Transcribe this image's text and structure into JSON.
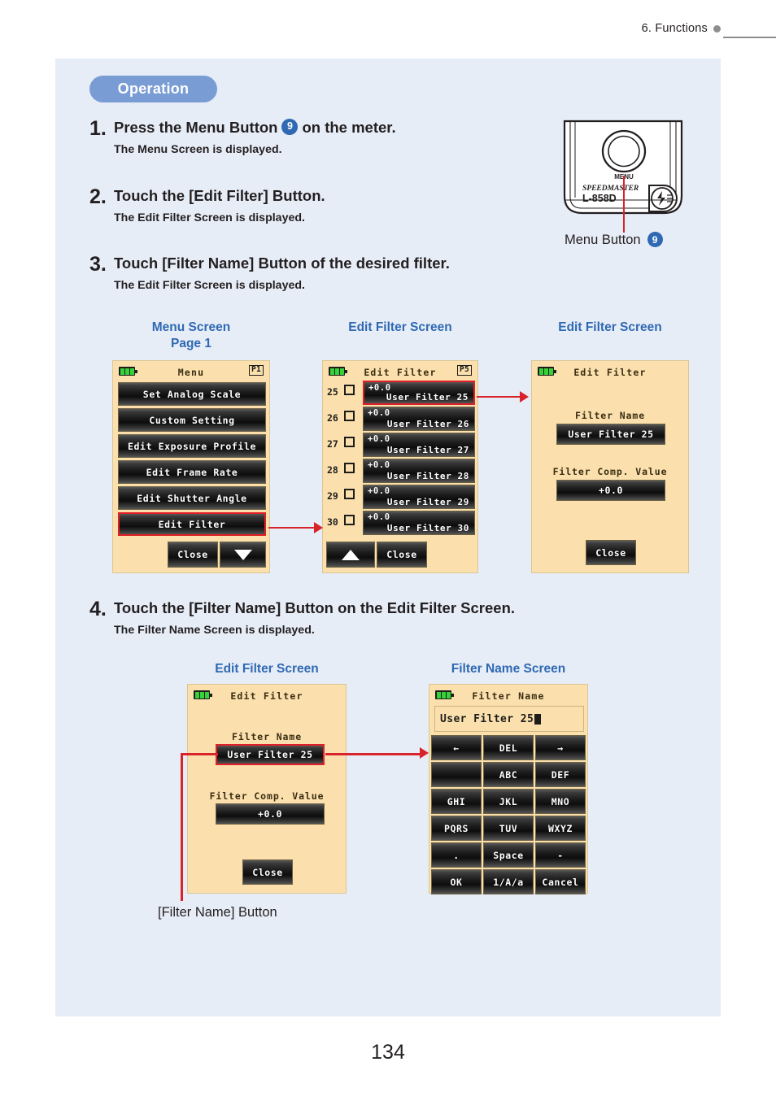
{
  "header": {
    "chapter": "6.  Functions"
  },
  "folio": {
    "page_number": "134"
  },
  "operation": {
    "pill_label": "Operation"
  },
  "steps": [
    {
      "num": "1.",
      "title_a": "Press the Menu Button",
      "badge": "9",
      "title_b": "on the meter.",
      "sub": "The Menu Screen is displayed."
    },
    {
      "num": "2.",
      "title": "Touch the [Edit Filter] Button.",
      "sub": "The Edit Filter Screen is displayed."
    },
    {
      "num": "3.",
      "title": "Touch [Filter Name] Button of the desired filter.",
      "sub": "The Edit Filter Screen is displayed."
    },
    {
      "num": "4.",
      "title": "Touch the [Filter Name] Button on the Edit Filter Screen.",
      "sub": "The Filter Name Screen is displayed."
    }
  ],
  "meter": {
    "brand": "SPEEDMASTER",
    "model": "L-858D",
    "button_label": "MENU",
    "caption": "Menu Button",
    "caption_badge": "9"
  },
  "captions": {
    "menu_screen": "Menu Screen",
    "menu_screen_page": "Page 1",
    "edit_filter_screen": "Edit Filter Screen",
    "edit_filter_screen_2": "Edit Filter Screen",
    "edit_filter_screen_3": "Edit Filter Screen",
    "filter_name_screen": "Filter Name Screen",
    "filter_name_button": "[Filter Name] Button"
  },
  "menu_screen": {
    "title": "Menu",
    "page_indicator": "P1",
    "items": [
      "Set Analog Scale",
      "Custom Setting",
      "Edit Exposure Profile",
      "Edit Frame Rate",
      "Edit Shutter Angle",
      "Edit Filter"
    ],
    "selected_item": "Edit Filter",
    "close_label": "Close",
    "scroll_down_icon": "triangle-down-icon"
  },
  "filter_list_screen": {
    "title": "Edit Filter",
    "page_indicator": "P5",
    "rows": [
      {
        "index": "25",
        "value": "+0.0",
        "name": "User Filter 25",
        "selected": true
      },
      {
        "index": "26",
        "value": "+0.0",
        "name": "User Filter 26",
        "selected": false
      },
      {
        "index": "27",
        "value": "+0.0",
        "name": "User Filter 27",
        "selected": false
      },
      {
        "index": "28",
        "value": "+0.0",
        "name": "User Filter 28",
        "selected": false
      },
      {
        "index": "29",
        "value": "+0.0",
        "name": "User Filter 29",
        "selected": false
      },
      {
        "index": "30",
        "value": "+0.0",
        "name": "User Filter 30",
        "selected": false
      }
    ],
    "scroll_up_icon": "triangle-up-icon",
    "close_label": "Close"
  },
  "edit_filter_detail": {
    "title": "Edit Filter",
    "filter_name_label": "Filter Name",
    "filter_name_value": "User Filter 25",
    "filter_comp_label": "Filter Comp. Value",
    "filter_comp_value": "+0.0",
    "close_label": "Close"
  },
  "edit_filter_detail_b": {
    "title": "Edit Filter",
    "filter_name_label": "Filter Name",
    "filter_name_value": "User Filter 25",
    "filter_comp_label": "Filter Comp. Value",
    "filter_comp_value": "+0.0",
    "close_label": "Close"
  },
  "filter_name_screen": {
    "title": "Filter Name",
    "input_value": "User Filter 25",
    "keys": [
      [
        "←",
        "DEL",
        "→"
      ],
      [
        "",
        "ABC",
        "DEF"
      ],
      [
        "GHI",
        "JKL",
        "MNO"
      ],
      [
        "PQRS",
        "TUV",
        "WXYZ"
      ],
      [
        ".",
        "Space",
        "-"
      ],
      [
        "OK",
        "1/A/a",
        "Cancel"
      ]
    ]
  },
  "colors": {
    "panel_bg": "#e7edf7",
    "pill_bg": "#7a9cd4",
    "caption_blue": "#2f69b3",
    "lcd_bg": "#fbe0ad",
    "accent_red": "#d8232a",
    "badge_blue": "#2f69b3"
  }
}
